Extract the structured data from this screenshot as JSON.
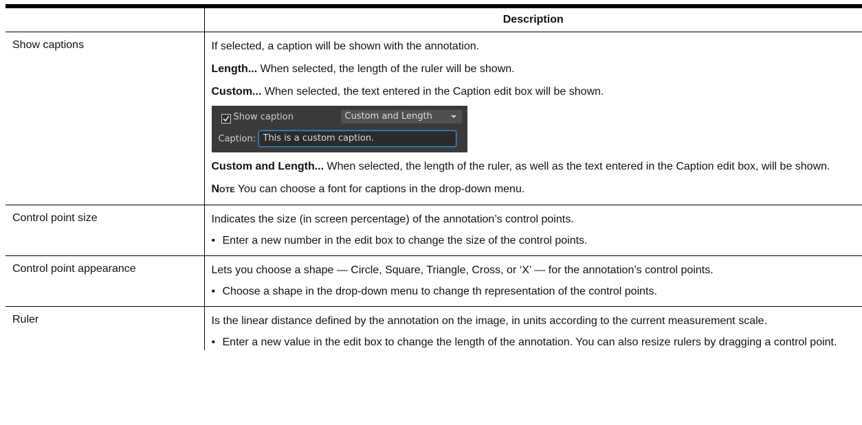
{
  "table": {
    "header": {
      "col1": "",
      "col2": "Description"
    },
    "show_captions": {
      "name": "Show captions",
      "p1": "If selected, a caption will be shown with the annotation.",
      "p2_bold": "Length...",
      "p2_text": " When selected, the length of the ruler will be shown.",
      "p3_bold": "Custom...",
      "p3_text": " When selected, the text entered in the Caption edit box will be shown.",
      "widget": {
        "checkbox_label": "Show caption",
        "checkbox_checked": true,
        "dropdown_value": "Custom and Length",
        "caption_label": "Caption:",
        "caption_value": "This is a custom caption.",
        "background_color": "#3a3a3a",
        "focus_color": "#3d8ee0"
      },
      "p4_bold": "Custom and Length...",
      "p4_text": " When selected, the length of the ruler, as well as the text entered in the Caption edit box, will be shown.",
      "note_label": "Note",
      "note_text": " You can choose a font for captions in the drop-down menu."
    },
    "control_point_size": {
      "name": "Control point size",
      "p1": "Indicates the size (in screen percentage) of the annotation’s control points.",
      "bullet1": "Enter a new number in the edit box to change the size of the control points."
    },
    "control_point_appearance": {
      "name": "Control point appearance",
      "p1": "Lets you choose a shape — Circle, Square, Triangle, Cross, or ‘X’ — for the annotation’s control points.",
      "bullet1": "Choose a shape in the drop-down menu to change th representation of the control points."
    },
    "ruler": {
      "name": "Ruler",
      "p1": "Is the linear distance defined by the annotation on the image, in units according to the current measurement scale.",
      "bullet1": "Enter a new value in the edit box to change the length of the annotation. You can also resize rulers by dragging a control point."
    },
    "bullet_char": "•"
  }
}
